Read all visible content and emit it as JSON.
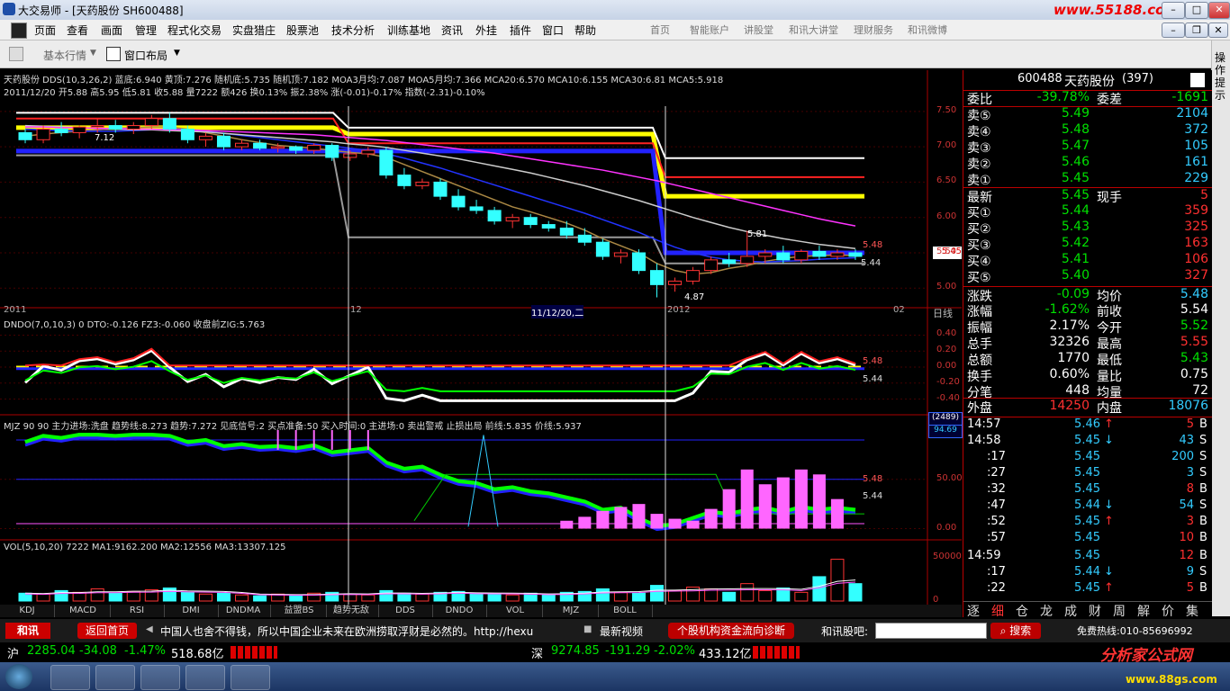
{
  "window": {
    "app_name": "大交易师",
    "doc_title": "[天药股份 SH600488]",
    "brand_url": "www.55188.com"
  },
  "menu": [
    "页面",
    "查看",
    "画面",
    "管理",
    "程式化交易",
    "实盘猎庄",
    "股票池",
    "技术分析",
    "训练基地",
    "资讯",
    "外挂",
    "插件",
    "窗口",
    "帮助"
  ],
  "nav_links": [
    "首页",
    "智能账户",
    "讲股堂",
    "和讯大讲堂",
    "理财服务",
    "和讯微博"
  ],
  "toolbar": {
    "basic_quote": "基本行情",
    "window_layout": "窗口布局"
  },
  "sidebar_tab": "操作提示",
  "main_chart": {
    "header_line1": "天药股份 DDS(10,3,26,2) 蓝底:6.940 黄顶:7.276 随机底:5.735 随机顶:7.182 MOA3月均:7.087 MOA5月均:7.366 MCA20:6.570 MCA10:6.155 MCA30:6.81 MCA5:5.918",
    "header_line2": "2011/12/20 开5.88 高5.95 低5.81 收5.88 量7222 额426 换0.13% 振2.38% 涨(-0.01)-0.17% 指数(-2.31)-0.10%",
    "y_ticks": [
      "7.50",
      "7.00",
      "6.50",
      "6.00",
      "5.50",
      "5.00"
    ],
    "annotations": {
      "high": "7.12",
      "low": "4.87",
      "mid": "5.81",
      "last": "5.44",
      "price_tag": "5.45",
      "price_top": "5.48"
    },
    "x_labels": [
      "2011",
      "12",
      "11/12/20,二",
      "2012",
      "02"
    ],
    "period": "日线"
  },
  "dndo_panel": {
    "header": "DNDO(7,0,10,3) 0 DTO:-0.126 FZ3:-0.060 收盘前ZIG:5.763",
    "y_ticks": [
      "0.40",
      "0.20",
      "0.00",
      "-0.20",
      "-0.40"
    ],
    "price_labels": [
      "5.48",
      "5.44"
    ]
  },
  "mjz_panel": {
    "header": "MJZ 90 90 主力进场:洗盘 趋势线:8.273 趋势:7.272 见底信号:2 买点准备:50 买入时间:0 主进场:0 卖出警戒 止损出局 前线:5.835 价线:5.937",
    "badge_a": "(2489)",
    "badge_b": "94.69",
    "y_ticks": [
      "50.00",
      "0.00"
    ],
    "price_labels": [
      "5.48",
      "5.44"
    ]
  },
  "vol_panel": {
    "header": "VOL(5,10,20) 7222 MA1:9162.200 MA2:12556 MA3:13307.125",
    "y_ticks": [
      "50000",
      "0"
    ]
  },
  "bottom_tabs": [
    "KDJ",
    "MACD",
    "RSI",
    "DMI",
    "DNDMA",
    "益盟BS",
    "趋势无敌",
    "DDS",
    "DNDO",
    "VOL",
    "MJZ",
    "BOLL"
  ],
  "quote": {
    "code": "600488",
    "name": "天药股份",
    "num": "(397)",
    "weibi_label": "委比",
    "weibi_value": "-39.78%",
    "weicha_label": "委差",
    "weicha_value": "-1691",
    "sells": [
      {
        "label": "卖⑤",
        "price": "5.49",
        "vol": "2104"
      },
      {
        "label": "卖④",
        "price": "5.48",
        "vol": "372"
      },
      {
        "label": "卖③",
        "price": "5.47",
        "vol": "105"
      },
      {
        "label": "卖②",
        "price": "5.46",
        "vol": "161"
      },
      {
        "label": "卖①",
        "price": "5.45",
        "vol": "229"
      }
    ],
    "latest_label": "最新",
    "latest": "5.45",
    "xianshou_label": "现手",
    "xianshou": "5",
    "buys": [
      {
        "label": "买①",
        "price": "5.44",
        "vol": "359"
      },
      {
        "label": "买②",
        "price": "5.43",
        "vol": "325"
      },
      {
        "label": "买③",
        "price": "5.42",
        "vol": "163"
      },
      {
        "label": "买④",
        "price": "5.41",
        "vol": "106"
      },
      {
        "label": "买⑤",
        "price": "5.40",
        "vol": "327"
      }
    ],
    "stats": [
      {
        "l1": "涨跌",
        "v1": "-0.09",
        "l2": "均价",
        "v2": "5.48",
        "c1": "green",
        "c2": "cyan"
      },
      {
        "l1": "涨幅",
        "v1": "-1.62%",
        "l2": "前收",
        "v2": "5.54",
        "c1": "green",
        "c2": "white"
      },
      {
        "l1": "振幅",
        "v1": "2.17%",
        "l2": "今开",
        "v2": "5.52",
        "c1": "white",
        "c2": "green"
      },
      {
        "l1": "总手",
        "v1": "32326",
        "l2": "最高",
        "v2": "5.55",
        "c1": "white",
        "c2": "red"
      },
      {
        "l1": "总额",
        "v1": "1770",
        "l2": "最低",
        "v2": "5.43",
        "c1": "white",
        "c2": "green"
      },
      {
        "l1": "换手",
        "v1": "0.60%",
        "l2": "量比",
        "v2": "0.75",
        "c1": "white",
        "c2": "white"
      },
      {
        "l1": "分笔",
        "v1": "448",
        "l2": "均量",
        "v2": "72",
        "c1": "white",
        "c2": "white"
      }
    ],
    "waipan_label": "外盘",
    "waipan": "14250",
    "neipan_label": "内盘",
    "neipan": "18076"
  },
  "ticks": [
    {
      "time": "14:57",
      "price": "5.46",
      "arrow": "up",
      "vol": "5",
      "side": "B"
    },
    {
      "time": "14:58",
      "price": "5.45",
      "arrow": "down",
      "vol": "43",
      "side": "S"
    },
    {
      "time": ":17",
      "price": "5.45",
      "arrow": "",
      "vol": "200",
      "side": "S"
    },
    {
      "time": ":27",
      "price": "5.45",
      "arrow": "",
      "vol": "3",
      "side": "S"
    },
    {
      "time": ":32",
      "price": "5.45",
      "arrow": "",
      "vol": "8",
      "side": "B"
    },
    {
      "time": ":47",
      "price": "5.44",
      "arrow": "down",
      "vol": "54",
      "side": "S"
    },
    {
      "time": ":52",
      "price": "5.45",
      "arrow": "up",
      "vol": "3",
      "side": "B"
    },
    {
      "time": ":57",
      "price": "5.45",
      "arrow": "",
      "vol": "10",
      "side": "B"
    },
    {
      "time": "14:59",
      "price": "5.45",
      "arrow": "",
      "vol": "12",
      "side": "B"
    },
    {
      "time": ":17",
      "price": "5.44",
      "arrow": "down",
      "vol": "9",
      "side": "S"
    },
    {
      "time": ":22",
      "price": "5.45",
      "arrow": "up",
      "vol": "5",
      "side": "B"
    }
  ],
  "right_tabs": [
    "逐",
    "细",
    "仓",
    "龙",
    "成",
    "财",
    "周",
    "解",
    "价",
    "集"
  ],
  "newsbar": {
    "logo": "和讯",
    "home": "返回首页",
    "ticker": "中国人也舍不得钱，所以中国企业未来在欧洲捞取浮财是必然的。http://hexu",
    "video": "最新视频",
    "diagnose": "个股机构资金流向诊断",
    "forum": "和讯股吧:",
    "search": "搜索",
    "hotline": "免费热线:010-85696992"
  },
  "status": {
    "sh_label": "沪",
    "sh_index": "2285.04",
    "sh_change": "-34.08",
    "sh_pct": "-1.47%",
    "sh_amount": "518.68亿",
    "sz_label": "深",
    "sz_index": "9274.85",
    "sz_change": "-191.29",
    "sz_pct": "-2.02%",
    "sz_amount": "433.12亿",
    "site_name": "分析家公式网",
    "site_url": "www.88gs.com"
  },
  "chart_data": {
    "type": "candlestick",
    "y_range": [
      4.8,
      7.6
    ],
    "candles": [
      [
        7.2,
        7.25,
        7.05,
        7.1
      ],
      [
        7.1,
        7.3,
        7.05,
        7.25
      ],
      [
        7.25,
        7.35,
        7.15,
        7.2
      ],
      [
        7.2,
        7.3,
        7.12,
        7.28
      ],
      [
        7.28,
        7.4,
        7.2,
        7.3
      ],
      [
        7.3,
        7.38,
        7.2,
        7.25
      ],
      [
        7.25,
        7.35,
        7.18,
        7.3
      ],
      [
        7.3,
        7.45,
        7.25,
        7.4
      ],
      [
        7.4,
        7.48,
        7.2,
        7.25
      ],
      [
        7.25,
        7.3,
        7.05,
        7.1
      ],
      [
        7.1,
        7.2,
        7.0,
        7.15
      ],
      [
        7.15,
        7.2,
        6.95,
        7.0
      ],
      [
        7.0,
        7.1,
        6.95,
        7.05
      ],
      [
        7.05,
        7.1,
        6.95,
        6.98
      ],
      [
        6.98,
        7.05,
        6.92,
        7.0
      ],
      [
        7.0,
        7.02,
        6.9,
        6.95
      ],
      [
        6.95,
        7.05,
        6.9,
        7.02
      ],
      [
        7.02,
        7.05,
        6.8,
        6.85
      ],
      [
        6.85,
        6.95,
        6.8,
        6.9
      ],
      [
        6.9,
        7.0,
        6.85,
        6.95
      ],
      [
        6.95,
        7.0,
        6.55,
        6.6
      ],
      [
        6.6,
        6.7,
        6.4,
        6.45
      ],
      [
        6.45,
        6.55,
        6.4,
        6.5
      ],
      [
        6.5,
        6.55,
        6.25,
        6.3
      ],
      [
        6.3,
        6.4,
        6.1,
        6.15
      ],
      [
        6.15,
        6.25,
        6.05,
        6.1
      ],
      [
        6.1,
        6.15,
        5.9,
        5.95
      ],
      [
        5.95,
        6.05,
        5.85,
        6.0
      ],
      [
        6.0,
        6.05,
        5.85,
        5.9
      ],
      [
        5.9,
        5.95,
        5.8,
        5.85
      ],
      [
        5.85,
        5.95,
        5.7,
        5.75
      ],
      [
        5.75,
        5.85,
        5.6,
        5.65
      ],
      [
        5.65,
        5.7,
        5.4,
        5.45
      ],
      [
        5.45,
        5.55,
        5.35,
        5.5
      ],
      [
        5.5,
        5.55,
        5.2,
        5.25
      ],
      [
        5.25,
        5.35,
        4.87,
        5.05
      ],
      [
        5.05,
        5.15,
        4.95,
        5.1
      ],
      [
        5.1,
        5.3,
        5.05,
        5.25
      ],
      [
        5.25,
        5.45,
        5.2,
        5.4
      ],
      [
        5.4,
        5.5,
        5.3,
        5.35
      ],
      [
        5.35,
        5.81,
        5.3,
        5.45
      ],
      [
        5.45,
        5.55,
        5.35,
        5.5
      ],
      [
        5.5,
        5.6,
        5.35,
        5.4
      ],
      [
        5.4,
        5.55,
        5.35,
        5.52
      ],
      [
        5.52,
        5.6,
        5.4,
        5.45
      ],
      [
        5.45,
        5.55,
        5.4,
        5.5
      ],
      [
        5.5,
        5.55,
        5.4,
        5.45
      ]
    ],
    "ma_series": [
      {
        "name": "MCA5",
        "color": "#aa8844",
        "values": [
          7.15,
          7.18,
          7.2,
          7.22,
          7.24,
          7.26,
          7.27,
          7.28,
          7.28,
          7.25,
          7.2,
          7.15,
          7.1,
          7.06,
          7.02,
          7.0,
          6.98,
          6.95,
          6.92,
          6.9,
          6.85,
          6.75,
          6.65,
          6.55,
          6.45,
          6.35,
          6.25,
          6.15,
          6.08,
          6.0,
          5.92,
          5.82,
          5.7,
          5.6,
          5.5,
          5.35,
          5.25,
          5.2,
          5.22,
          5.28,
          5.32,
          5.38,
          5.42,
          5.45,
          5.46,
          5.47,
          5.46
        ]
      },
      {
        "name": "MCA10",
        "color": "#2233ff",
        "values": [
          7.25,
          7.24,
          7.23,
          7.22,
          7.22,
          7.22,
          7.23,
          7.24,
          7.25,
          7.24,
          7.22,
          7.19,
          7.16,
          7.13,
          7.1,
          7.07,
          7.04,
          7.01,
          6.98,
          6.95,
          6.9,
          6.84,
          6.77,
          6.7,
          6.62,
          6.54,
          6.46,
          6.38,
          6.3,
          6.22,
          6.14,
          6.06,
          5.97,
          5.88,
          5.79,
          5.68,
          5.58,
          5.5,
          5.44,
          5.4,
          5.38,
          5.37,
          5.38,
          5.39,
          5.41,
          5.42,
          5.43
        ]
      },
      {
        "name": "MCA20",
        "color": "#cccccc",
        "values": [
          7.3,
          7.29,
          7.28,
          7.27,
          7.26,
          7.25,
          7.24,
          7.24,
          7.23,
          7.22,
          7.21,
          7.19,
          7.17,
          7.15,
          7.13,
          7.11,
          7.09,
          7.07,
          7.04,
          7.02,
          6.99,
          6.95,
          6.91,
          6.87,
          6.83,
          6.78,
          6.73,
          6.68,
          6.63,
          6.57,
          6.51,
          6.45,
          6.38,
          6.31,
          6.24,
          6.16,
          6.08,
          6.0,
          5.93,
          5.86,
          5.8,
          5.75,
          5.7,
          5.66,
          5.62,
          5.59,
          5.56
        ]
      },
      {
        "name": "MCA30",
        "color": "#ff33ff",
        "values": [
          7.28,
          7.28,
          7.27,
          7.27,
          7.26,
          7.26,
          7.25,
          7.25,
          7.24,
          7.24,
          7.23,
          7.22,
          7.21,
          7.2,
          7.19,
          7.18,
          7.17,
          7.15,
          7.13,
          7.11,
          7.09,
          7.06,
          7.03,
          7.0,
          6.97,
          6.94,
          6.91,
          6.87,
          6.83,
          6.79,
          6.75,
          6.71,
          6.67,
          6.62,
          6.57,
          6.52,
          6.46,
          6.4,
          6.34,
          6.28,
          6.22,
          6.16,
          6.1,
          6.04,
          5.98,
          5.93,
          5.88
        ]
      }
    ],
    "volume": [
      9,
      8,
      12,
      10,
      14,
      9,
      11,
      13,
      15,
      10,
      8,
      9,
      7,
      6,
      8,
      7,
      9,
      10,
      8,
      7,
      12,
      9,
      8,
      10,
      11,
      9,
      8,
      7,
      9,
      8,
      10,
      11,
      14,
      10,
      9,
      18,
      12,
      16,
      14,
      10,
      20,
      12,
      15,
      10,
      28,
      48,
      20
    ]
  }
}
